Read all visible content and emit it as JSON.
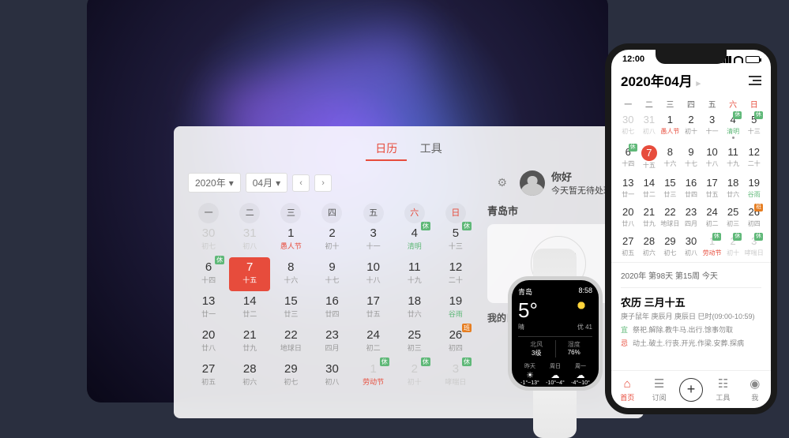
{
  "desktop": {
    "tabs": {
      "calendar": "日历",
      "tools": "工具"
    },
    "year": "2020年",
    "month": "04月",
    "user": {
      "greet": "你好",
      "status": "今天暂无待处理日程"
    },
    "dow": [
      "一",
      "二",
      "三",
      "四",
      "五",
      "六",
      "日"
    ],
    "days": [
      {
        "n": "30",
        "s": "初七",
        "dim": true
      },
      {
        "n": "31",
        "s": "初八",
        "dim": true
      },
      {
        "n": "1",
        "s": "愚人节",
        "fest": true
      },
      {
        "n": "2",
        "s": "初十"
      },
      {
        "n": "3",
        "s": "十一"
      },
      {
        "n": "4",
        "s": "清明",
        "term": true,
        "xiu": true
      },
      {
        "n": "5",
        "s": "十三",
        "xiu": true
      },
      {
        "n": "6",
        "s": "十四",
        "xiu": true
      },
      {
        "n": "7",
        "s": "十五",
        "sel": true
      },
      {
        "n": "8",
        "s": "十六"
      },
      {
        "n": "9",
        "s": "十七"
      },
      {
        "n": "10",
        "s": "十八"
      },
      {
        "n": "11",
        "s": "十九"
      },
      {
        "n": "12",
        "s": "二十"
      },
      {
        "n": "13",
        "s": "廿一"
      },
      {
        "n": "14",
        "s": "廿二"
      },
      {
        "n": "15",
        "s": "廿三"
      },
      {
        "n": "16",
        "s": "廿四"
      },
      {
        "n": "17",
        "s": "廿五"
      },
      {
        "n": "18",
        "s": "廿六"
      },
      {
        "n": "19",
        "s": "谷雨",
        "term": true
      },
      {
        "n": "20",
        "s": "廿八"
      },
      {
        "n": "21",
        "s": "廿九"
      },
      {
        "n": "22",
        "s": "地球日"
      },
      {
        "n": "23",
        "s": "四月"
      },
      {
        "n": "24",
        "s": "初二"
      },
      {
        "n": "25",
        "s": "初三"
      },
      {
        "n": "26",
        "s": "初四",
        "ban": true
      },
      {
        "n": "27",
        "s": "初五"
      },
      {
        "n": "28",
        "s": "初六"
      },
      {
        "n": "29",
        "s": "初七"
      },
      {
        "n": "30",
        "s": "初八"
      },
      {
        "n": "1",
        "s": "劳动节",
        "dim": true,
        "fest": true,
        "xiu": true
      },
      {
        "n": "2",
        "s": "初十",
        "dim": true,
        "xiu": true
      },
      {
        "n": "3",
        "s": "哮喘日",
        "dim": true,
        "xiu": true
      }
    ],
    "city": "青岛市",
    "my_schedule": "我的日程",
    "badge_xiu": "休",
    "badge_ban": "班"
  },
  "phone": {
    "time": "12:00",
    "title": "2020年04月",
    "dow": [
      "一",
      "二",
      "三",
      "四",
      "五",
      "六",
      "日"
    ],
    "days": [
      {
        "n": "30",
        "s": "初七",
        "dim": true
      },
      {
        "n": "31",
        "s": "初八",
        "dim": true
      },
      {
        "n": "1",
        "s": "愚人节",
        "fest": true
      },
      {
        "n": "2",
        "s": "初十"
      },
      {
        "n": "3",
        "s": "十一"
      },
      {
        "n": "4",
        "s": "清明",
        "term": true,
        "xiu": true,
        "dot": true
      },
      {
        "n": "5",
        "s": "十三",
        "xiu": true
      },
      {
        "n": "6",
        "s": "十四",
        "xiu": true
      },
      {
        "n": "7",
        "s": "十五",
        "sel": true
      },
      {
        "n": "8",
        "s": "十六"
      },
      {
        "n": "9",
        "s": "十七"
      },
      {
        "n": "10",
        "s": "十八"
      },
      {
        "n": "11",
        "s": "十九"
      },
      {
        "n": "12",
        "s": "二十"
      },
      {
        "n": "13",
        "s": "廿一"
      },
      {
        "n": "14",
        "s": "廿二"
      },
      {
        "n": "15",
        "s": "廿三"
      },
      {
        "n": "16",
        "s": "廿四"
      },
      {
        "n": "17",
        "s": "廿五"
      },
      {
        "n": "18",
        "s": "廿六"
      },
      {
        "n": "19",
        "s": "谷雨",
        "term": true
      },
      {
        "n": "20",
        "s": "廿八"
      },
      {
        "n": "21",
        "s": "廿九"
      },
      {
        "n": "22",
        "s": "地球日"
      },
      {
        "n": "23",
        "s": "四月"
      },
      {
        "n": "24",
        "s": "初二"
      },
      {
        "n": "25",
        "s": "初三"
      },
      {
        "n": "26",
        "s": "初四",
        "ban": true
      },
      {
        "n": "27",
        "s": "初五"
      },
      {
        "n": "28",
        "s": "初六"
      },
      {
        "n": "29",
        "s": "初七"
      },
      {
        "n": "30",
        "s": "初八"
      },
      {
        "n": "1",
        "s": "劳动节",
        "dim": true,
        "fest": true,
        "xiu": true
      },
      {
        "n": "2",
        "s": "初十",
        "dim": true,
        "xiu": true
      },
      {
        "n": "3",
        "s": "哮喘日",
        "dim": true,
        "xiu": true
      }
    ],
    "summary": "2020年 第98天 第15周 今天",
    "lunar": "农历 三月十五",
    "lunar_sub": "庚子鼠年 庚辰月 庚辰日 巳时(09:00-10:59)",
    "yi_tag": "宜",
    "yi": "祭祀.解除.教牛马.出行.馀事勿取",
    "ji_tag": "忌",
    "ji": "动土.破土.行丧.开光.作梁.安葬.探病",
    "tabs": {
      "home": "首页",
      "sub": "订阅",
      "tool": "工具",
      "me": "我"
    },
    "badge_xiu": "休",
    "badge_ban": "班"
  },
  "watch": {
    "city": "青岛",
    "time": "8:58",
    "temp": "5°",
    "cond_l": "晴",
    "cond_r": "优 41",
    "wind_lbl": "北风",
    "wind_val": "3级",
    "hum_lbl": "湿度",
    "hum_val": "76%",
    "forecast": [
      {
        "d": "昨天",
        "ic": "☀",
        "t": "-1°~13°"
      },
      {
        "d": "周日",
        "ic": "☁",
        "t": "-10°~4°"
      },
      {
        "d": "周一",
        "ic": "☁",
        "t": "-4°~10°"
      }
    ]
  }
}
